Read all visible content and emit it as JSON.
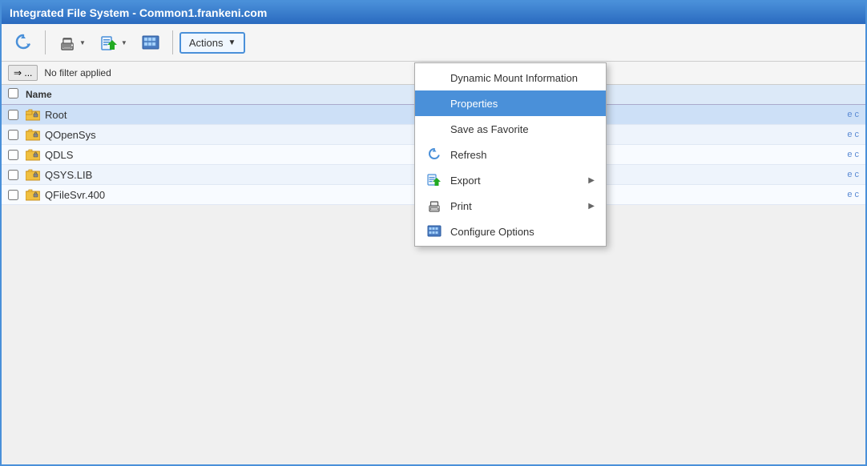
{
  "window": {
    "title": "Integrated File System - Common1.frankeni.com"
  },
  "toolbar": {
    "actions_label": "Actions",
    "dropdown_arrow": "▼"
  },
  "filter": {
    "filter_btn_label": "⇒ ...",
    "filter_text": "No filter applied"
  },
  "table": {
    "columns": [
      "Name"
    ],
    "rows": [
      {
        "name": "Root",
        "selected": true
      },
      {
        "name": "QOpenSys",
        "selected": false
      },
      {
        "name": "QDLS",
        "selected": false
      },
      {
        "name": "QSYS.LIB",
        "selected": false
      },
      {
        "name": "QFileSvr.400",
        "selected": false
      }
    ],
    "truncated_label": "e c"
  },
  "dropdown": {
    "items": [
      {
        "id": "dynamic-mount",
        "label": "Dynamic Mount Information",
        "has_icon": false,
        "has_submenu": false,
        "highlighted": false
      },
      {
        "id": "properties",
        "label": "Properties",
        "has_icon": false,
        "has_submenu": false,
        "highlighted": true
      },
      {
        "id": "save-favorite",
        "label": "Save as Favorite",
        "has_icon": false,
        "has_submenu": false,
        "highlighted": false
      },
      {
        "id": "refresh",
        "label": "Refresh",
        "has_icon": true,
        "icon_type": "refresh",
        "has_submenu": false,
        "highlighted": false
      },
      {
        "id": "export",
        "label": "Export",
        "has_icon": true,
        "icon_type": "export",
        "has_submenu": true,
        "highlighted": false
      },
      {
        "id": "print",
        "label": "Print",
        "has_icon": true,
        "icon_type": "print",
        "has_submenu": true,
        "highlighted": false
      },
      {
        "id": "configure",
        "label": "Configure Options",
        "has_icon": true,
        "icon_type": "configure",
        "has_submenu": false,
        "highlighted": false
      }
    ]
  }
}
